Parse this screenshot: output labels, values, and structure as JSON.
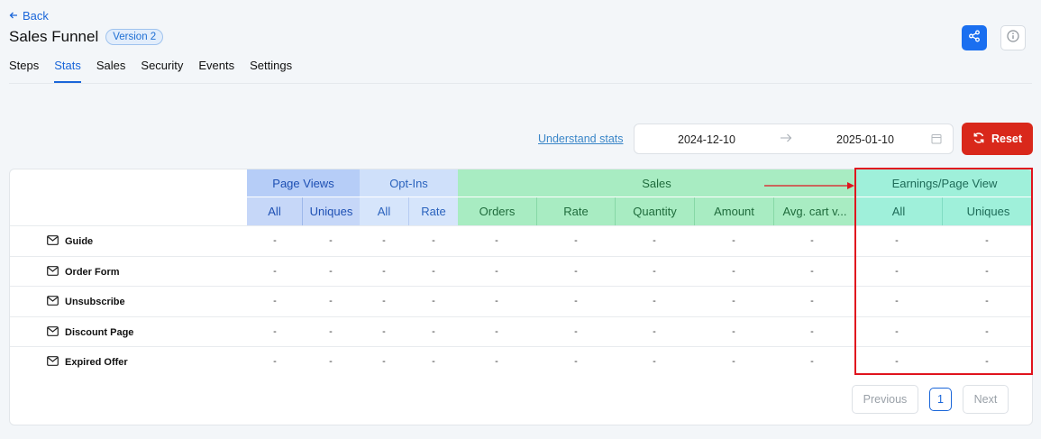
{
  "nav": {
    "back_label": "Back"
  },
  "header": {
    "title": "Sales Funnel",
    "version_badge": "Version 2"
  },
  "tabs": [
    {
      "label": "Steps",
      "active": false
    },
    {
      "label": "Stats",
      "active": true
    },
    {
      "label": "Sales",
      "active": false
    },
    {
      "label": "Security",
      "active": false
    },
    {
      "label": "Events",
      "active": false
    },
    {
      "label": "Settings",
      "active": false
    }
  ],
  "toolbar": {
    "understand_link": "Understand stats",
    "date_from": "2024-12-10",
    "date_to": "2025-01-10",
    "reset_label": "Reset"
  },
  "table": {
    "groups": {
      "page_views": "Page Views",
      "opt_ins": "Opt-Ins",
      "sales": "Sales",
      "earnings": "Earnings/Page View"
    },
    "columns": {
      "pv_all": "All",
      "pv_uniques": "Uniques",
      "oi_all": "All",
      "oi_rate": "Rate",
      "orders": "Orders",
      "rate": "Rate",
      "quantity": "Quantity",
      "amount": "Amount",
      "avg_cart": "Avg. cart v...",
      "ep_all": "All",
      "ep_uniques": "Uniques"
    },
    "rows": [
      {
        "name": "Guide",
        "values": [
          "-",
          "-",
          "-",
          "-",
          "-",
          "-",
          "-",
          "-",
          "-",
          "-",
          "-"
        ]
      },
      {
        "name": "Order Form",
        "values": [
          "-",
          "-",
          "-",
          "-",
          "-",
          "-",
          "-",
          "-",
          "-",
          "-",
          "-"
        ]
      },
      {
        "name": "Unsubscribe",
        "values": [
          "-",
          "-",
          "-",
          "-",
          "-",
          "-",
          "-",
          "-",
          "-",
          "-",
          "-"
        ]
      },
      {
        "name": "Discount Page",
        "values": [
          "-",
          "-",
          "-",
          "-",
          "-",
          "-",
          "-",
          "-",
          "-",
          "-",
          "-"
        ]
      },
      {
        "name": "Expired Offer",
        "values": [
          "-",
          "-",
          "-",
          "-",
          "-",
          "-",
          "-",
          "-",
          "-",
          "-",
          "-"
        ]
      }
    ]
  },
  "pagination": {
    "previous": "Previous",
    "page": "1",
    "next": "Next"
  },
  "colors": {
    "accent": "#1a6ff0",
    "reset": "#d9281b",
    "page_views_header": "#b6cdf7",
    "sales_header": "#a8ecc2",
    "earnings_header": "#9ff0da",
    "annotation": "#e0141e"
  },
  "icons": [
    "arrow-left-icon",
    "share-icon",
    "info-icon",
    "calendar-icon",
    "refresh-icon",
    "mail-icon"
  ]
}
